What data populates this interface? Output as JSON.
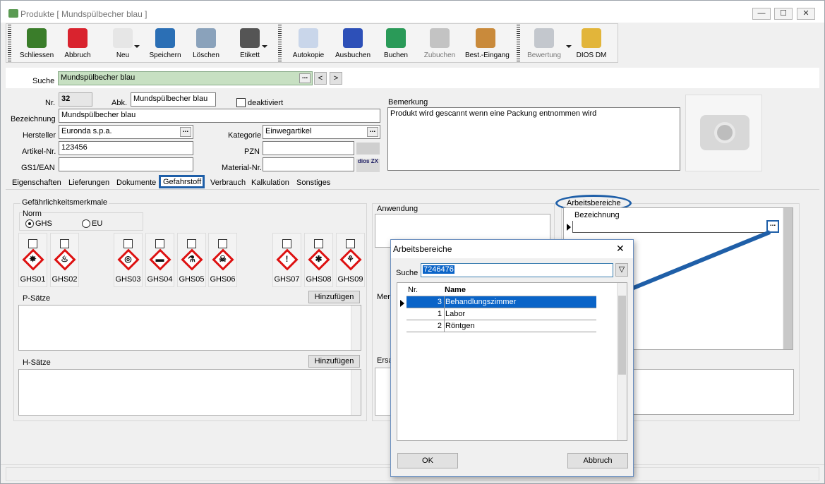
{
  "window": {
    "title": "Produkte [ Mundspülbecher blau ]",
    "btn_min": "—",
    "btn_max": "☐",
    "btn_close": "✕"
  },
  "toolbar": {
    "items": [
      {
        "label": "Schliessen",
        "color": "#3a7d2a"
      },
      {
        "label": "Abbruch",
        "color": "#d9232e"
      },
      {
        "label": "Neu",
        "color": "#e6e6e6"
      },
      {
        "label": "Speichern",
        "color": "#2b6fb5"
      },
      {
        "label": "Löschen",
        "color": "#8aa2bb"
      },
      {
        "label": "Etikett",
        "color": "#555555"
      },
      {
        "label": "Autokopie",
        "color": "#c9d6ea"
      },
      {
        "label": "Ausbuchen",
        "color": "#2d50b8"
      },
      {
        "label": "Buchen",
        "color": "#2a9a58"
      },
      {
        "label": "Zubuchen",
        "color": "#9a9a9a"
      },
      {
        "label": "Best.-Eingang",
        "color": "#c98a3b"
      },
      {
        "label": "Bewertung",
        "color": "#9aa3ad"
      },
      {
        "label": "DIOS DM",
        "color": "#e2b53a"
      }
    ]
  },
  "search": {
    "label": "Suche",
    "value": "Mundspülbecher blau",
    "prev": "<",
    "next": ">"
  },
  "form": {
    "nr_label": "Nr.",
    "nr_value": "32",
    "abk_label": "Abk.",
    "abk_value": "Mundspülbecher blau",
    "deaktiviert_label": "deaktiviert",
    "bez_label": "Bezeichnung",
    "bez_value": "Mundspülbecher blau",
    "hersteller_label": "Hersteller",
    "hersteller_value": "Euronda s.p.a.",
    "kategorie_label": "Kategorie",
    "kategorie_value": "Einwegartikel",
    "artikel_label": "Artikel-Nr.",
    "artikel_value": "123456",
    "pzn_label": "PZN",
    "pzn_value": "",
    "gs1_label": "GS1/EAN",
    "gs1_value": "",
    "material_label": "Material-Nr.",
    "material_value": "",
    "bemerkung_label": "Bemerkung",
    "bemerkung_value": "Produkt wird gescannt wenn eine Packung entnommen wird",
    "dios_badge": "dios ZX"
  },
  "tabs": [
    "Eigenschaften",
    "Lieferungen",
    "Dokumente",
    "Gefahrstoff",
    "Verbrauch",
    "Kalkulation",
    "Sonstiges"
  ],
  "gefahr": {
    "group_title": "Gefährlichkeitsmerkmale",
    "norm_label": "Norm",
    "ghs": "GHS",
    "eu": "EU",
    "ghs_items": [
      {
        "label": "GHS01",
        "sym": "✸"
      },
      {
        "label": "GHS02",
        "sym": "♨"
      },
      {
        "label": "GHS03",
        "sym": "◎"
      },
      {
        "label": "GHS04",
        "sym": "▬"
      },
      {
        "label": "GHS05",
        "sym": "⚗"
      },
      {
        "label": "GHS06",
        "sym": "☠"
      },
      {
        "label": "GHS07",
        "sym": "!"
      },
      {
        "label": "GHS08",
        "sym": "✱"
      },
      {
        "label": "GHS09",
        "sym": "⚘"
      }
    ],
    "psatze": "P-Sätze",
    "hsatze": "H-Sätze",
    "hinzufuegen": "Hinzufügen",
    "anwendung": "Anwendung",
    "mer": "Mer",
    "ersa": "Ersa"
  },
  "arbeitsbereiche": {
    "title": "Arbeitsbereiche",
    "col": "Bezeichnung"
  },
  "dialog": {
    "title": "Arbeitsbereiche",
    "close": "✕",
    "search_label": "Suche",
    "search_value": "7246476",
    "col_nr": "Nr.",
    "col_name": "Name",
    "rows": [
      {
        "nr": "3",
        "name": "Behandlungszimmer"
      },
      {
        "nr": "1",
        "name": "Labor"
      },
      {
        "nr": "2",
        "name": "Röntgen"
      }
    ],
    "ok": "OK",
    "cancel": "Abbruch"
  },
  "colors": {
    "highlight_blue": "#1f5fa8",
    "selection": "#0a64c8",
    "search_green": "#c7e0c2"
  }
}
